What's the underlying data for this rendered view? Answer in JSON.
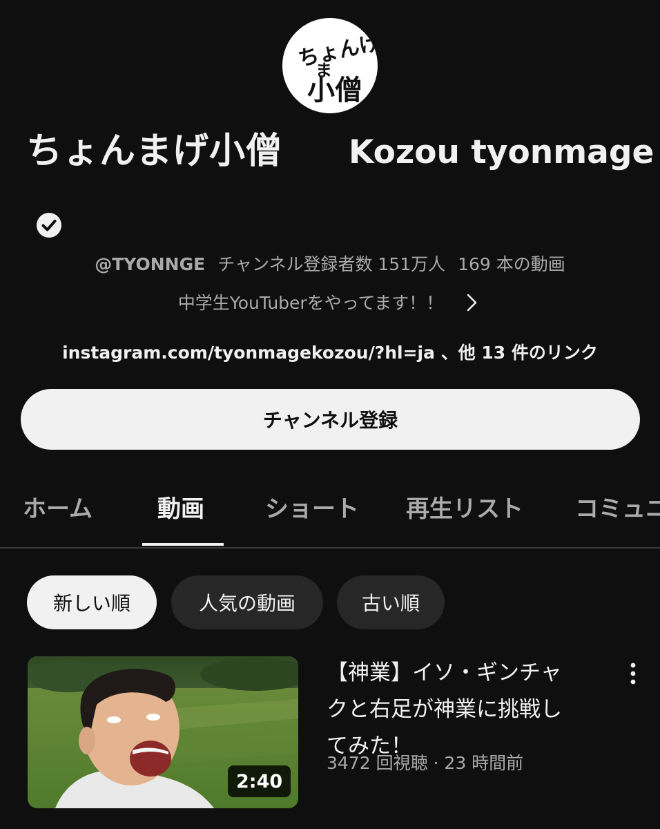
{
  "channel": {
    "avatar_text_lines": [
      "ちょんげ",
      "ま",
      "小僧"
    ],
    "name_jp": "ちょんまげ小僧",
    "name_en": "Kozou tyonmage",
    "verified_icon": "verified-check-icon",
    "handle": "@TYONNGE",
    "subscribers": "チャンネル登録者数 151万人",
    "video_count": "169 本の動画",
    "description": "中学生YouTuberをやってます！！",
    "links": "instagram.com/tyonmagekozou/?hl=ja 、他 13 件のリンク",
    "subscribe_label": "チャンネル登録"
  },
  "tabs": [
    {
      "label": "ホーム",
      "active": false
    },
    {
      "label": "動画",
      "active": true
    },
    {
      "label": "ショート",
      "active": false
    },
    {
      "label": "再生リスト",
      "active": false
    },
    {
      "label": "コミュニ",
      "active": false
    }
  ],
  "chips": [
    {
      "label": "新しい順",
      "selected": true
    },
    {
      "label": "人気の動画",
      "selected": false
    },
    {
      "label": "古い順",
      "selected": false
    }
  ],
  "videos": [
    {
      "title": "【神業】イソ・ギンチャクと右足が神業に挑戦してみた！",
      "title_lines": [
        "【神業】イソ・ギンチャ",
        "クと右足が神業に挑戦し",
        "てみた！"
      ],
      "meta": "3472 回視聴 · 23 時間前",
      "duration": "2:40"
    }
  ],
  "colors": {
    "background": "#0f0f0f",
    "text_primary": "#f1f1f1",
    "text_secondary": "#aaaaaa",
    "chip_bg": "#272727"
  }
}
